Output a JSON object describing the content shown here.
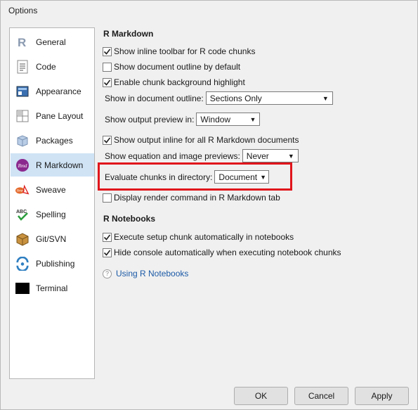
{
  "window": {
    "title": "Options"
  },
  "sidebar": {
    "items": [
      {
        "label": "General",
        "icon": "r-logo-icon"
      },
      {
        "label": "Code",
        "icon": "code-document-icon"
      },
      {
        "label": "Appearance",
        "icon": "appearance-icon"
      },
      {
        "label": "Pane Layout",
        "icon": "pane-layout-icon"
      },
      {
        "label": "Packages",
        "icon": "packages-icon"
      },
      {
        "label": "R Markdown",
        "icon": "rmd-icon",
        "selected": true
      },
      {
        "label": "Sweave",
        "icon": "sweave-pdf-icon"
      },
      {
        "label": "Spelling",
        "icon": "spelling-abc-icon"
      },
      {
        "label": "Git/SVN",
        "icon": "git-box-icon"
      },
      {
        "label": "Publishing",
        "icon": "publishing-icon"
      },
      {
        "label": "Terminal",
        "icon": "terminal-icon"
      }
    ]
  },
  "rmarkdown": {
    "title": "R Markdown",
    "show_inline_toolbar": {
      "label": "Show inline toolbar for R code chunks",
      "checked": true
    },
    "show_outline_default": {
      "label": "Show document outline by default",
      "checked": false
    },
    "enable_chunk_highlight": {
      "label": "Enable chunk background highlight",
      "checked": true
    },
    "show_in_outline": {
      "label": "Show in document outline:",
      "value": "Sections Only"
    },
    "output_preview": {
      "label": "Show output preview in:",
      "value": "Window"
    },
    "show_output_inline": {
      "label": "Show output inline for all R Markdown documents",
      "checked": true
    },
    "equation_previews": {
      "label": "Show equation and image previews:",
      "value": "Never"
    },
    "evaluate_chunks": {
      "label": "Evaluate chunks in directory:",
      "value": "Document"
    },
    "display_render": {
      "label": "Display render command in R Markdown tab",
      "checked": false
    }
  },
  "notebooks": {
    "title": "R Notebooks",
    "execute_setup": {
      "label": "Execute setup chunk automatically in notebooks",
      "checked": true
    },
    "hide_console": {
      "label": "Hide console automatically when executing notebook chunks",
      "checked": true
    },
    "help_link": "Using R Notebooks"
  },
  "buttons": {
    "ok": "OK",
    "cancel": "Cancel",
    "apply": "Apply"
  },
  "colors": {
    "highlight": "#e0151b",
    "selected": "#cfe3f5",
    "link": "#1c5aa6"
  }
}
